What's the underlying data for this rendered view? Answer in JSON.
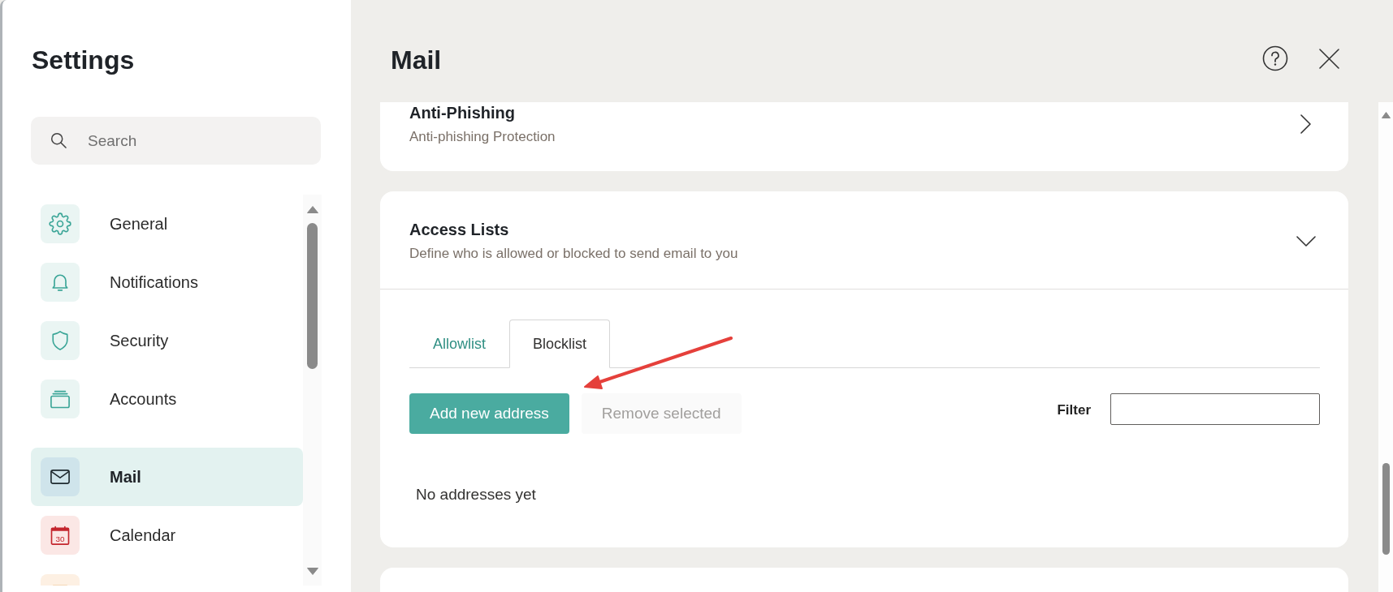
{
  "sidebar": {
    "title": "Settings",
    "search": {
      "placeholder": "Search"
    },
    "groups": [
      {
        "items": [
          {
            "kind": "gear",
            "label": "General",
            "selected": false
          },
          {
            "kind": "bell",
            "label": "Notifications",
            "selected": false
          },
          {
            "kind": "shield",
            "label": "Security",
            "selected": false
          },
          {
            "kind": "stack",
            "label": "Accounts",
            "selected": false
          }
        ]
      },
      {
        "items": [
          {
            "kind": "envelope",
            "label": "Mail",
            "selected": true
          },
          {
            "kind": "calendar",
            "label": "Calendar",
            "icon_text": "30",
            "selected": false
          },
          {
            "kind": "box",
            "selected": false
          }
        ]
      }
    ]
  },
  "main": {
    "title": "Mail",
    "sections": [
      {
        "title": "Anti-Phishing",
        "subtitle": "Anti-phishing Protection",
        "expanded": false
      },
      {
        "title": "Access Lists",
        "subtitle": "Define who is allowed or blocked to send email to you",
        "expanded": true,
        "tabs": [
          {
            "label": "Allowlist",
            "selected": false
          },
          {
            "label": "Blocklist",
            "selected": true
          }
        ],
        "buttons": [
          {
            "label": "Add new address",
            "disabled": false
          },
          {
            "label": "Remove selected",
            "disabled": true
          }
        ],
        "filter": {
          "label": "Filter"
        },
        "empty_message": "No addresses yet"
      }
    ],
    "card_below": true
  },
  "annotations": [
    {
      "kind": "arrow"
    }
  ]
}
